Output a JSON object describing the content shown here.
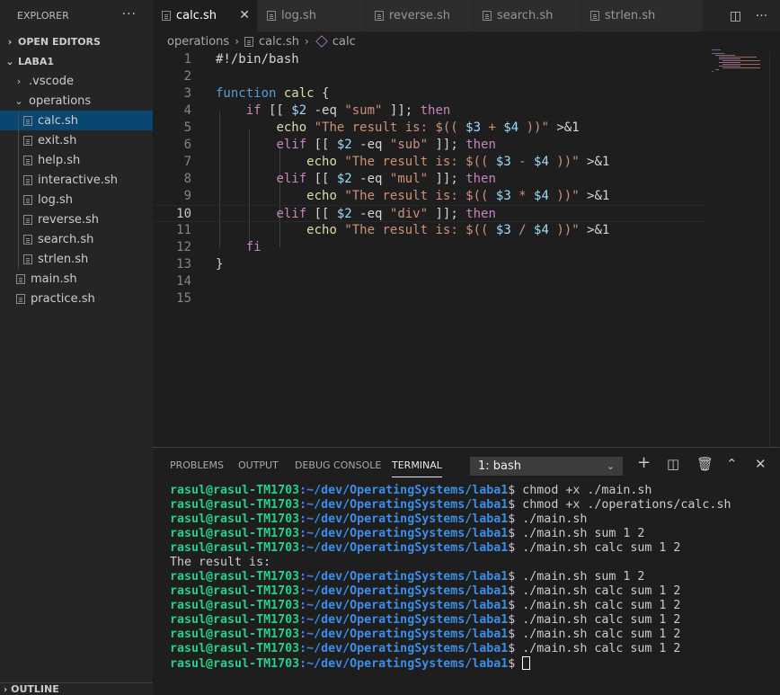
{
  "sidebar": {
    "title": "EXPLORER",
    "more": "···",
    "open_editors": "OPEN EDITORS",
    "workspace": "LABA1",
    "vscode_folder": ".vscode",
    "operations_folder": "operations",
    "operations_files": [
      "calc.sh",
      "exit.sh",
      "help.sh",
      "interactive.sh",
      "log.sh",
      "reverse.sh",
      "search.sh",
      "strlen.sh"
    ],
    "root_files": [
      "main.sh",
      "practice.sh"
    ],
    "outline": "OUTLINE"
  },
  "tabs": [
    {
      "label": "calc.sh",
      "active": true
    },
    {
      "label": "log.sh",
      "active": false
    },
    {
      "label": "reverse.sh",
      "active": false
    },
    {
      "label": "search.sh",
      "active": false
    },
    {
      "label": "strlen.sh",
      "active": false
    }
  ],
  "breadcrumb": {
    "folder": "operations",
    "file": "calc.sh",
    "symbol": "calc"
  },
  "editor": {
    "line_numbers": [
      "1",
      "2",
      "3",
      "4",
      "5",
      "6",
      "7",
      "8",
      "9",
      "10",
      "11",
      "12",
      "13",
      "14",
      "15"
    ],
    "current_line": 10
  },
  "panel": {
    "tabs": [
      "PROBLEMS",
      "OUTPUT",
      "DEBUG CONSOLE",
      "TERMINAL"
    ],
    "active_tab": "TERMINAL",
    "terminal_select": "1: bash",
    "prompt_user": "rasul@rasul-TM1703",
    "prompt_path": ":~/dev/OperatingSystems/laba1",
    "lines": [
      {
        "type": "prompt",
        "cmd": "$ chmod +x ./main.sh"
      },
      {
        "type": "prompt",
        "cmd": "$ chmod +x ./operations/calc.sh"
      },
      {
        "type": "prompt",
        "cmd": "$ ./main.sh"
      },
      {
        "type": "prompt",
        "cmd": "$ ./main.sh sum 1 2"
      },
      {
        "type": "prompt",
        "cmd": "$ ./main.sh calc sum 1 2"
      },
      {
        "type": "output",
        "text": "The result is:"
      },
      {
        "type": "prompt",
        "cmd": "$ ./main.sh sum 1 2"
      },
      {
        "type": "prompt",
        "cmd": "$ ./main.sh calc sum 1 2"
      },
      {
        "type": "prompt",
        "cmd": "$ ./main.sh calc sum 1 2"
      },
      {
        "type": "prompt",
        "cmd": "$ ./main.sh calc sum 1 2"
      },
      {
        "type": "prompt",
        "cmd": "$ ./main.sh calc sum 1 2"
      },
      {
        "type": "prompt",
        "cmd": "$ ./main.sh calc sum 1 2"
      },
      {
        "type": "prompt",
        "cmd": "$ ",
        "cursor": true
      }
    ]
  },
  "colors": {
    "accent_selection": "#094771",
    "prompt_user": "#23d18b",
    "prompt_path": "#3b8eea",
    "string": "#ce9178",
    "keyword": "#569cd6",
    "control": "#c586c0",
    "variable": "#9cdcfe",
    "function": "#dcdcaa"
  }
}
